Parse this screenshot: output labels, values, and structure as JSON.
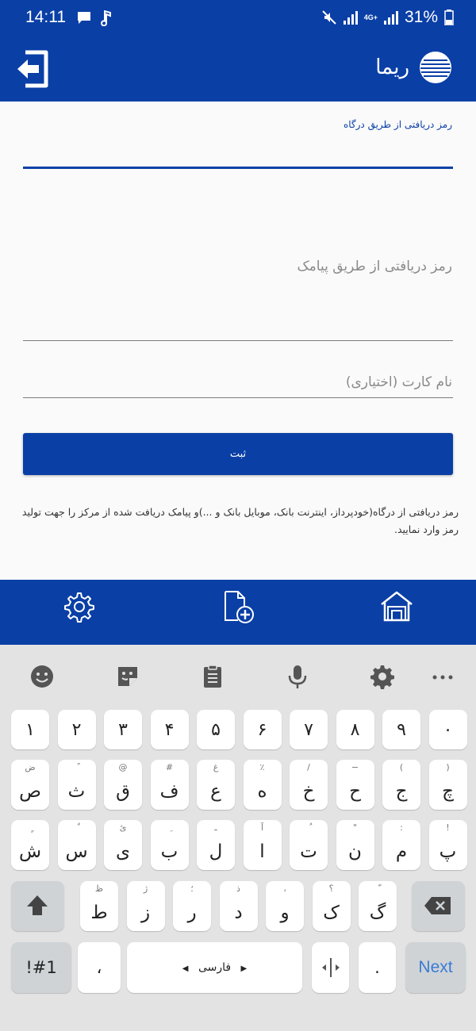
{
  "status_bar": {
    "time": "14:11",
    "network": "4G+",
    "battery": "31%"
  },
  "app_bar": {
    "title": "ریما"
  },
  "form": {
    "gateway_password_label": "رمز دریافتی از طریق درگاه",
    "sms_password_placeholder": "رمز دریافتی از طریق پیامک",
    "card_name_placeholder": "نام کارت (اختیاری)",
    "submit_label": "ثبت",
    "info_text": "رمز دریافتی از درگاه(خودپرداز، اینترنت بانک، موبایل بانک و ...)و پیامک دریافت شده از مرکز را جهت تولید رمز وارد نمایید."
  },
  "bottom_nav": {
    "items": [
      "settings-icon",
      "add-document-icon",
      "home-icon"
    ]
  },
  "keyboard": {
    "toolbar": [
      "emoji-icon",
      "sticker-icon",
      "clipboard-icon",
      "microphone-icon",
      "settings-icon",
      "more-icon"
    ],
    "digits": [
      "۱",
      "۲",
      "۳",
      "۴",
      "۵",
      "۶",
      "۷",
      "۸",
      "۹",
      "۰"
    ],
    "row1": [
      {
        "main": "ص",
        "sub": "ض"
      },
      {
        "main": "ث",
        "sub": "ً"
      },
      {
        "main": "ق",
        "sub": "@"
      },
      {
        "main": "ف",
        "sub": "#"
      },
      {
        "main": "ع",
        "sub": "غ"
      },
      {
        "main": "ه",
        "sub": "٪"
      },
      {
        "main": "خ",
        "sub": "/"
      },
      {
        "main": "ح",
        "sub": "−"
      },
      {
        "main": "ج",
        "sub": "("
      },
      {
        "main": "چ",
        "sub": ")"
      }
    ],
    "row2": [
      {
        "main": "ش",
        "sub": "ٍ"
      },
      {
        "main": "س",
        "sub": "ٌ"
      },
      {
        "main": "ی",
        "sub": "ئ"
      },
      {
        "main": "ب",
        "sub": "ِ"
      },
      {
        "main": "ل",
        "sub": "ـ"
      },
      {
        "main": "ا",
        "sub": "آ"
      },
      {
        "main": "ت",
        "sub": "ُ"
      },
      {
        "main": "ن",
        "sub": "\""
      },
      {
        "main": "م",
        "sub": ":"
      },
      {
        "main": "پ",
        "sub": "!"
      }
    ],
    "row3": [
      {
        "main": "ط",
        "sub": "ظ"
      },
      {
        "main": "ز",
        "sub": "ژ"
      },
      {
        "main": "ر",
        "sub": "؛"
      },
      {
        "main": "د",
        "sub": "ذ"
      },
      {
        "main": "و",
        "sub": "،"
      },
      {
        "main": "ک",
        "sub": "؟"
      },
      {
        "main": "گ",
        "sub": "ّ"
      }
    ],
    "symbols_label": "!#1",
    "comma_label": "،",
    "space_label": "فارسی",
    "period_label": ".",
    "next_label": "Next"
  },
  "colors": {
    "primary": "#0a3fa6",
    "keyboard_bg": "#e3e3e3",
    "key_bg": "#ffffff",
    "func_key_bg": "#cfd3d6",
    "next_text": "#3a7bd5"
  }
}
